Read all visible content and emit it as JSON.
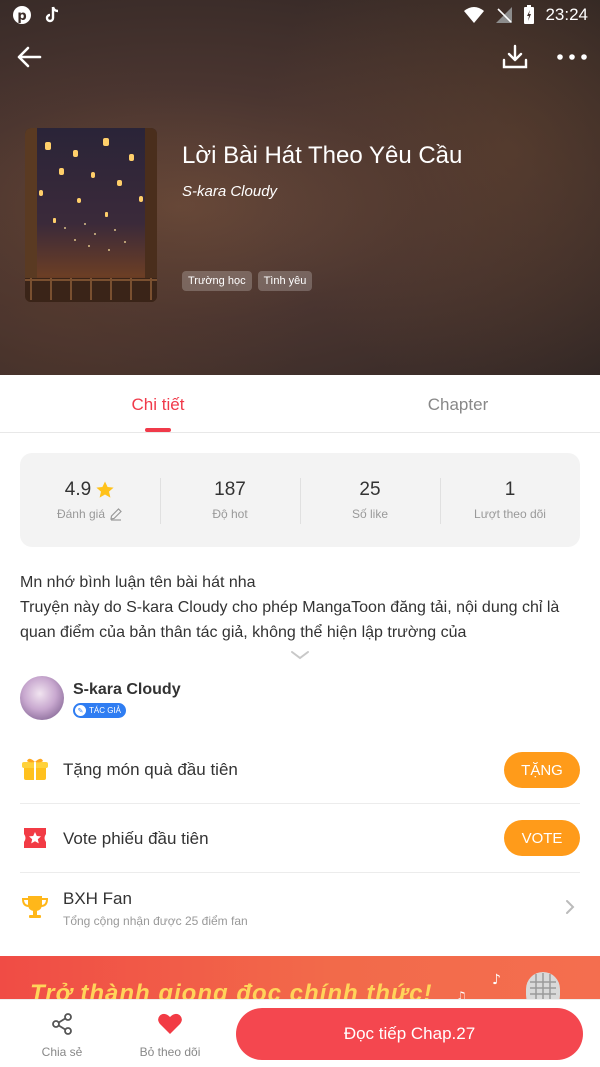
{
  "status_bar": {
    "time": "23:24",
    "left_icons": [
      "pinterest-icon",
      "tiktok-icon"
    ],
    "right_icons": [
      "wifi-icon",
      "no-signal-icon",
      "battery-charging-icon"
    ]
  },
  "header": {
    "actions": [
      "back-arrow-icon",
      "download-icon",
      "more-icon"
    ]
  },
  "book": {
    "title": "Lời Bài Hát Theo Yêu Cầu",
    "author": "S-kara Cloudy",
    "tags": [
      "Trường học",
      "Tình yêu"
    ]
  },
  "tabs": [
    {
      "label": "Chi tiết",
      "active": true
    },
    {
      "label": "Chapter",
      "active": false
    }
  ],
  "stats": [
    {
      "value": "4.9",
      "label": "Đánh giá"
    },
    {
      "value": "187",
      "label": "Độ hot"
    },
    {
      "value": "25",
      "label": "Số like"
    },
    {
      "value": "1",
      "label": "Lượt theo dõi"
    }
  ],
  "description": {
    "line1": "Mn nhớ bình luận tên bài hát nha",
    "line2": "Truyện này do S-kara Cloudy cho phép MangaToon đăng tải, nội dung chỉ là quan điểm của bản thân tác giả, không thể hiện lập trường của"
  },
  "author_card": {
    "name": "S-kara Cloudy",
    "badge": "TÁC GIẢ"
  },
  "actions": {
    "gift": {
      "label": "Tặng món quà đầu tiên",
      "button": "TẶNG"
    },
    "vote": {
      "label": "Vote phiếu đầu tiên",
      "button": "VOTE"
    },
    "fan": {
      "label": "BXH Fan",
      "subtitle": "Tổng cộng nhận được 25 điểm fan"
    }
  },
  "banner": {
    "text": "Trở thành giọng đọc chính thức!"
  },
  "bottom_bar": {
    "share_label": "Chia sẻ",
    "unfollow_label": "Bỏ theo dõi",
    "read_button": "Đọc tiếp Chap.27"
  },
  "colors": {
    "accent": "#f03a4a",
    "orange": "#ff9b1a",
    "read_button": "#f4474f",
    "author_badge": "#2f7df2"
  }
}
